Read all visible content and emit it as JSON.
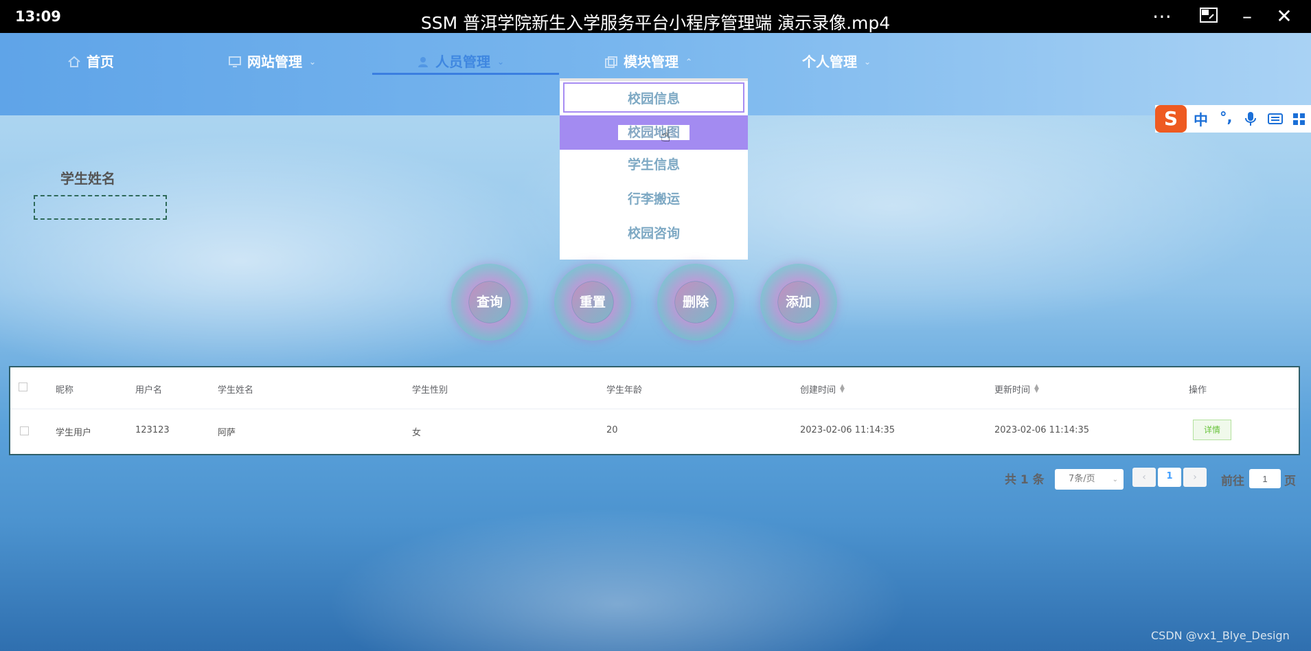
{
  "player": {
    "time": "13:09",
    "title": "SSM 普洱学院新生入学服务平台小程序管理端 演示录像.mp4",
    "more_icon": "more-icon",
    "pip_icon": "picture-in-picture-icon",
    "minimize_icon": "minimize-icon",
    "close_icon": "close-icon"
  },
  "nav": {
    "items": [
      {
        "label": "首页",
        "icon": "home-icon"
      },
      {
        "label": "网站管理",
        "icon": "monitor-icon"
      },
      {
        "label": "人员管理",
        "icon": "user-icon"
      },
      {
        "label": "模块管理",
        "icon": "copy-icon"
      },
      {
        "label": "个人管理",
        "icon": ""
      }
    ],
    "active": "人员管理"
  },
  "dropdown": {
    "items": [
      "校园信息",
      "校园地图",
      "学生信息",
      "行李搬运",
      "校园咨询"
    ],
    "hovered": "校园地图"
  },
  "ime": {
    "logo": "S",
    "lang": "中",
    "punct": "°,",
    "mic_icon": "microphone-icon",
    "keyboard_icon": "keyboard-icon",
    "apps_icon": "grid-icon"
  },
  "search": {
    "label": "学生姓名",
    "value": "",
    "placeholder": ""
  },
  "buttons": {
    "query": "查询",
    "reset": "重置",
    "delete": "删除",
    "add": "添加"
  },
  "table": {
    "headers": [
      "昵称",
      "用户名",
      "学生姓名",
      "学生性别",
      "学生年龄",
      "创建时间",
      "更新时间",
      "操作"
    ],
    "rows": [
      {
        "nickname": "学生用户",
        "username": "123123",
        "name": "阿萨",
        "gender": "女",
        "age": "20",
        "created": "2023-02-06 11:14:35",
        "updated": "2023-02-06 11:14:35",
        "action": "详情"
      }
    ]
  },
  "pagination": {
    "total_text": "共 1 条",
    "page_size": "7条/页",
    "current_page": "1",
    "goto_label": "前往",
    "goto_value": "1",
    "page_suffix": "页"
  },
  "watermark": "CSDN @vx1_Blye_Design",
  "colors": {
    "nav_active": "#3f87e0",
    "dropdown_hover": "#a38bf1",
    "detail_green": "#67c23a"
  }
}
